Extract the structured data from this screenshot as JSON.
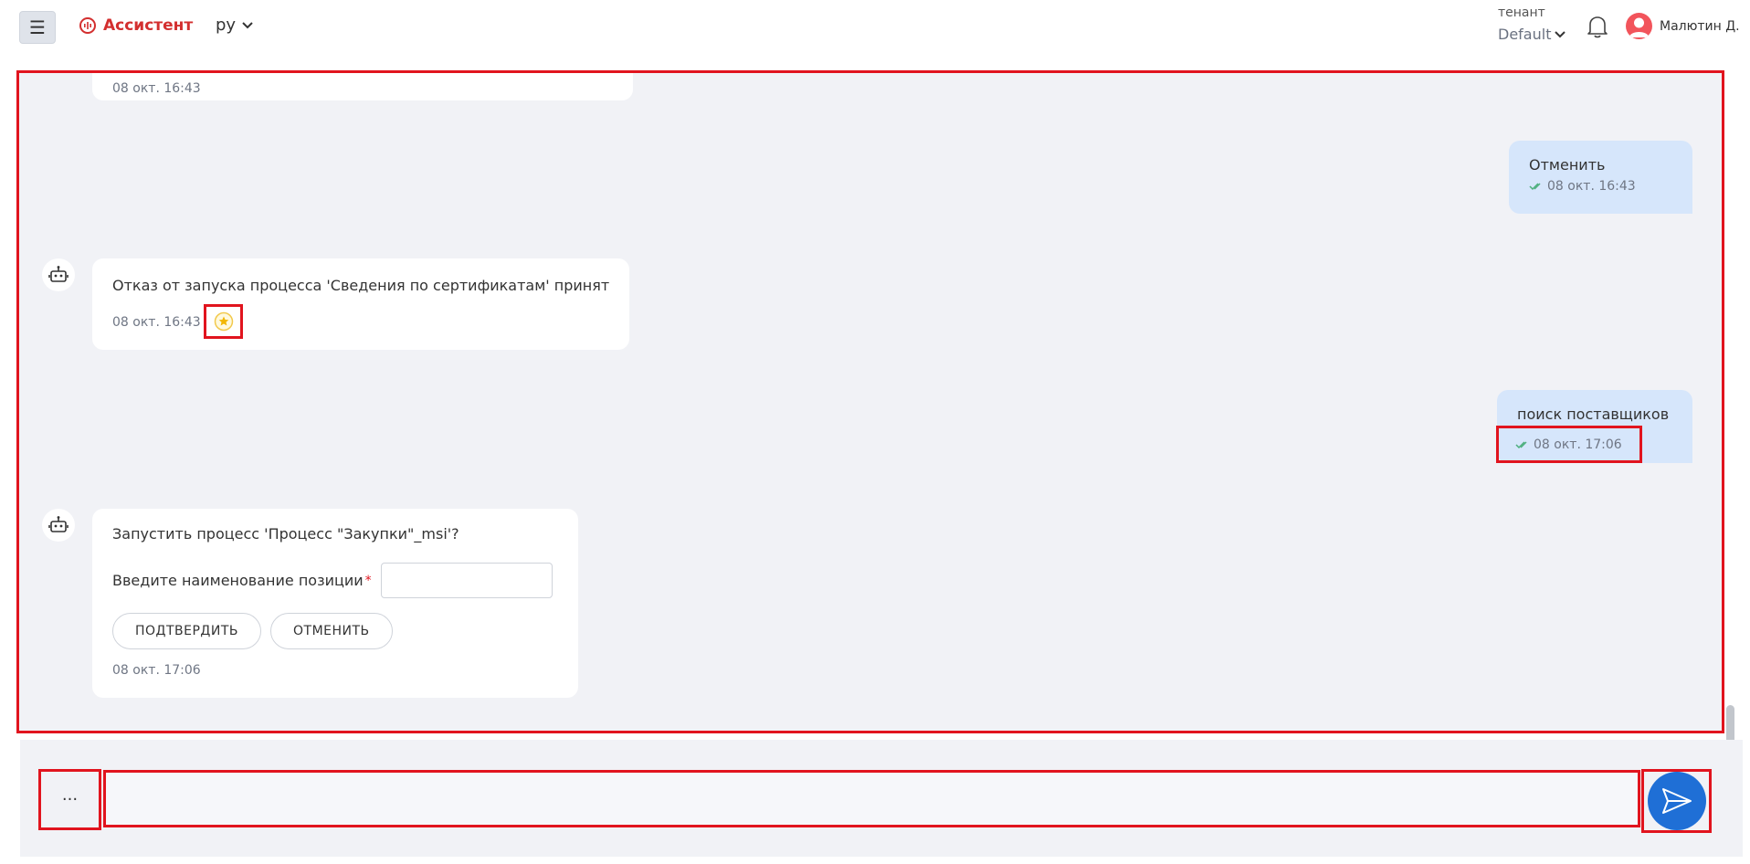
{
  "header": {
    "menu_icon": "☰",
    "app_title": "Ассистент",
    "language": "ру",
    "tenant_label": "тенант",
    "tenant_value": "Default",
    "user_name": "Малютин Д."
  },
  "messages": [
    {
      "role": "bot",
      "time": "08 окт. 16:43"
    },
    {
      "role": "user",
      "text": "Отменить",
      "time": "08 окт. 16:43"
    },
    {
      "role": "bot",
      "text": "Отказ от запуска процесса 'Сведения по сертификатам' принят",
      "time": "08 окт. 16:43"
    },
    {
      "role": "user",
      "text": "поиск поставщиков",
      "time": "08 окт. 17:06"
    },
    {
      "role": "bot",
      "text": "Запустить процесс 'Процесс \"Закупки\"_msi'?",
      "field_label": "Введите наименование позиции",
      "required_mark": "*",
      "confirm_label": "ПОДТВЕРДИТЬ",
      "cancel_label": "ОТМЕНИТЬ",
      "time": "08 окт. 17:06"
    }
  ],
  "composer": {
    "more_label": "···",
    "input_value": "",
    "input_placeholder": ""
  },
  "colors": {
    "accent": "#1f6fd6",
    "brand": "#d32f2f",
    "user_bubble": "#d6e6fb",
    "chat_bg": "#f1f2f6",
    "highlight": "#e1141e"
  }
}
